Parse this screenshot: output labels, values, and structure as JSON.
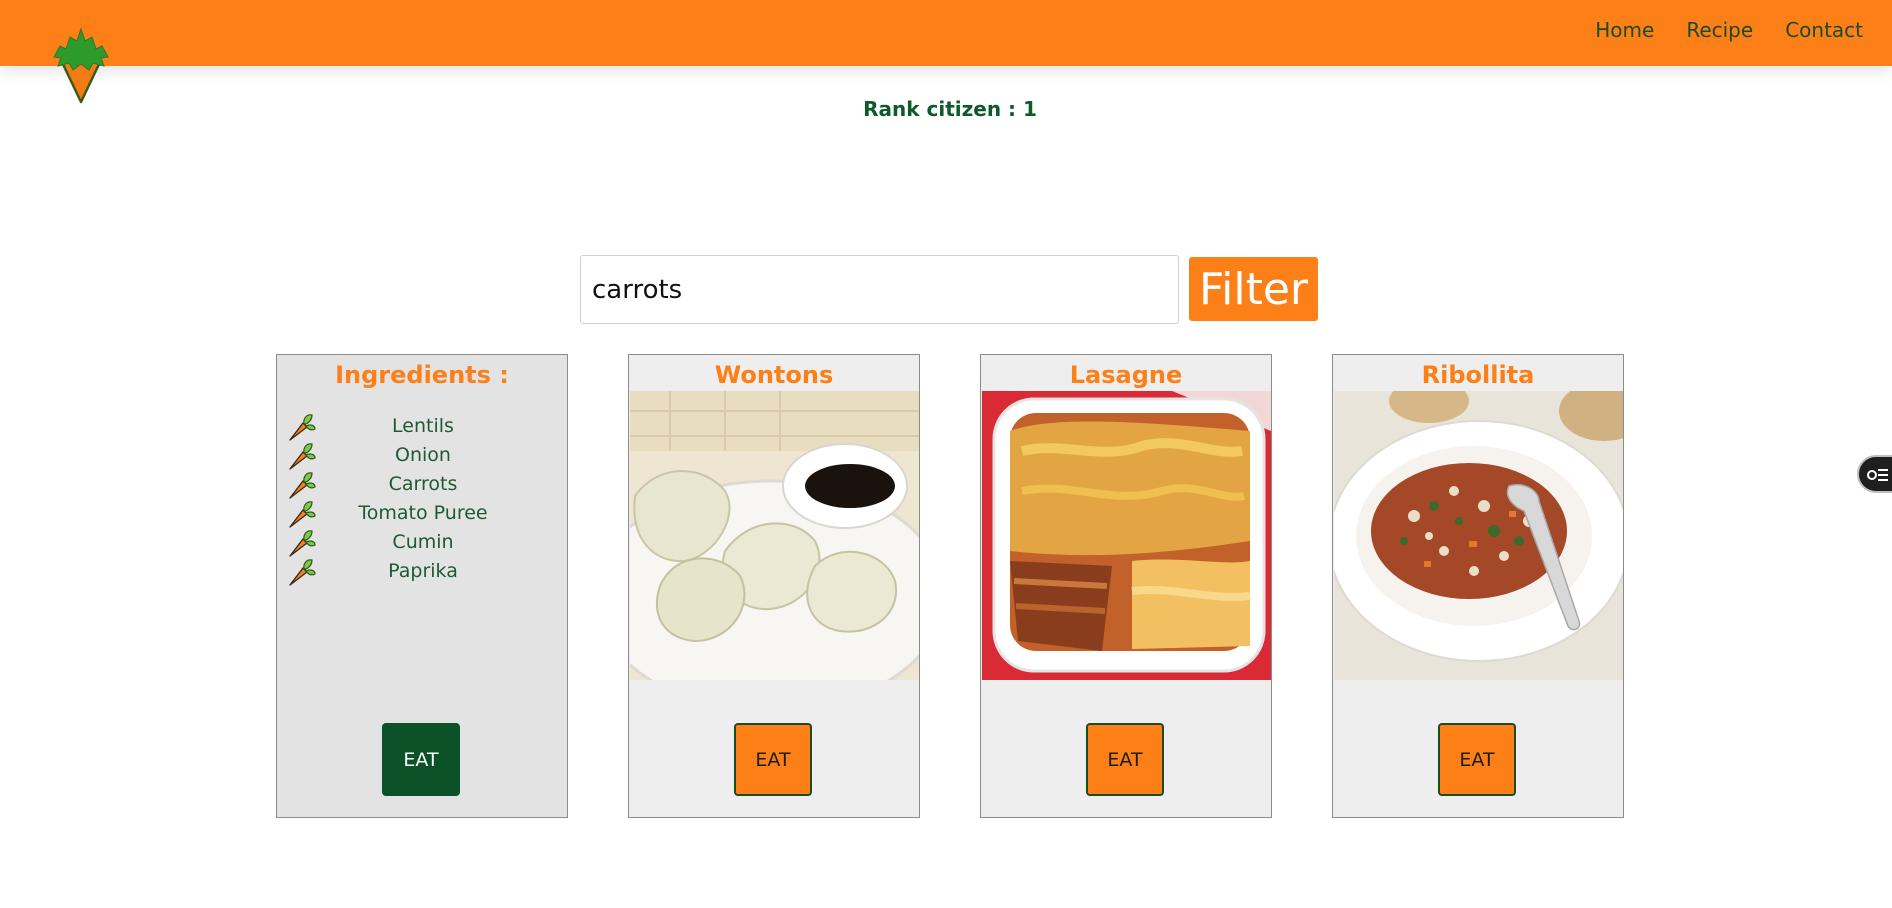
{
  "header": {
    "logo_icon": "carrot-logo-icon",
    "nav": [
      {
        "label": "Home"
      },
      {
        "label": "Recipe"
      },
      {
        "label": "Contact"
      }
    ]
  },
  "rank": {
    "text": "Rank citizen : 1"
  },
  "search": {
    "value": "carrots",
    "filter_label": "Filter"
  },
  "ingredients_card": {
    "title": "Ingredients :",
    "items": [
      "Lentils",
      "Onion",
      "Carrots",
      "Tomato Puree",
      "Cumin",
      "Paprika"
    ],
    "item_icon": "carrot-icon",
    "eat_label": "EAT"
  },
  "recipes": [
    {
      "title": "Wontons",
      "image": "wontons-photo",
      "eat_label": "EAT"
    },
    {
      "title": "Lasagne",
      "image": "lasagne-photo",
      "eat_label": "EAT"
    },
    {
      "title": "Ribollita",
      "image": "ribollita-photo",
      "eat_label": "EAT"
    }
  ],
  "colors": {
    "brand_orange": "#fc7f18",
    "dark_green": "#0b5228",
    "text_green": "#1e5a33"
  },
  "side_widget": {
    "icon": "toggle-list-icon"
  }
}
